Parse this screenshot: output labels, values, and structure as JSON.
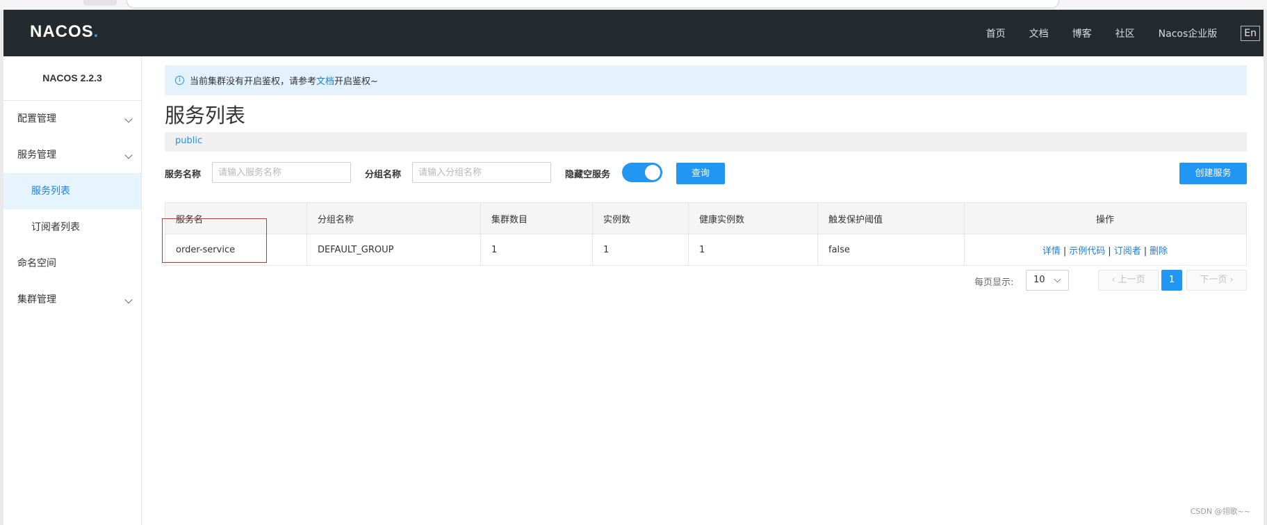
{
  "header": {
    "logo_main": "NACOS",
    "logo_dot": ".",
    "nav": [
      "首页",
      "文档",
      "博客",
      "社区",
      "Nacos企业版"
    ],
    "lang_button": "En"
  },
  "sidebar": {
    "version": "NACOS 2.2.3",
    "items": [
      {
        "label": "配置管理"
      },
      {
        "label": "服务管理"
      },
      {
        "label": "服务列表"
      },
      {
        "label": "订阅者列表"
      },
      {
        "label": "命名空间"
      },
      {
        "label": "集群管理"
      }
    ]
  },
  "alert": {
    "text_before": "当前集群没有开启鉴权，请参考",
    "link": "文档",
    "text_after": "开启鉴权~"
  },
  "page": {
    "title": "服务列表",
    "namespace": "public"
  },
  "filters": {
    "service_name_label": "服务名称",
    "service_name_placeholder": "请输入服务名称",
    "service_name_value": "",
    "group_name_label": "分组名称",
    "group_name_placeholder": "请输入分组名称",
    "group_name_value": "",
    "hide_empty_label": "隐藏空服务",
    "hide_empty_on": true,
    "query_button": "查询",
    "create_button": "创建服务"
  },
  "table": {
    "headers": [
      "服务名",
      "分组名称",
      "集群数目",
      "实例数",
      "健康实例数",
      "触发保护阈值",
      "操作"
    ],
    "rows": [
      {
        "cells": [
          "order-service",
          "DEFAULT_GROUP",
          "1",
          "1",
          "1",
          "false"
        ]
      }
    ],
    "ops": [
      "详情",
      "示例代码",
      "订阅者",
      "删除"
    ],
    "op_separator": "|"
  },
  "pagination": {
    "per_page_label": "每页显示:",
    "per_page_value": "10",
    "prev": "上一页",
    "current": "1",
    "next": "下一页"
  },
  "watermark": "CSDN @翎歌~~"
}
